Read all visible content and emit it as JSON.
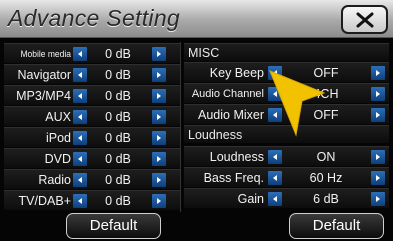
{
  "title": "Advance Setting",
  "close_icon": "close-x-icon",
  "left": {
    "rows": [
      {
        "label": "Mobile media",
        "value": "0 dB"
      },
      {
        "label": "Navigator",
        "value": "0 dB"
      },
      {
        "label": "MP3/MP4",
        "value": "0 dB"
      },
      {
        "label": "AUX",
        "value": "0 dB"
      },
      {
        "label": "iPod",
        "value": "0 dB"
      },
      {
        "label": "DVD",
        "value": "0 dB"
      },
      {
        "label": "Radio",
        "value": "0 dB"
      },
      {
        "label": "TV/DAB+",
        "value": "0 dB"
      }
    ],
    "default_label": "Default"
  },
  "right": {
    "misc_header": "MISC",
    "misc_rows": [
      {
        "label": "Key Beep",
        "value": "OFF"
      },
      {
        "label": "Audio Channel",
        "value": "4CH"
      },
      {
        "label": "Audio Mixer",
        "value": "OFF"
      }
    ],
    "loudness_header": "Loudness",
    "loudness_rows": [
      {
        "label": "Loudness",
        "value": "ON"
      },
      {
        "label": "Bass Freq.",
        "value": "60 Hz"
      },
      {
        "label": "Gain",
        "value": "6 dB"
      }
    ],
    "default_label": "Default"
  },
  "colors": {
    "arrow_button": "#1f5aa0",
    "pointer": "#f2c200"
  }
}
